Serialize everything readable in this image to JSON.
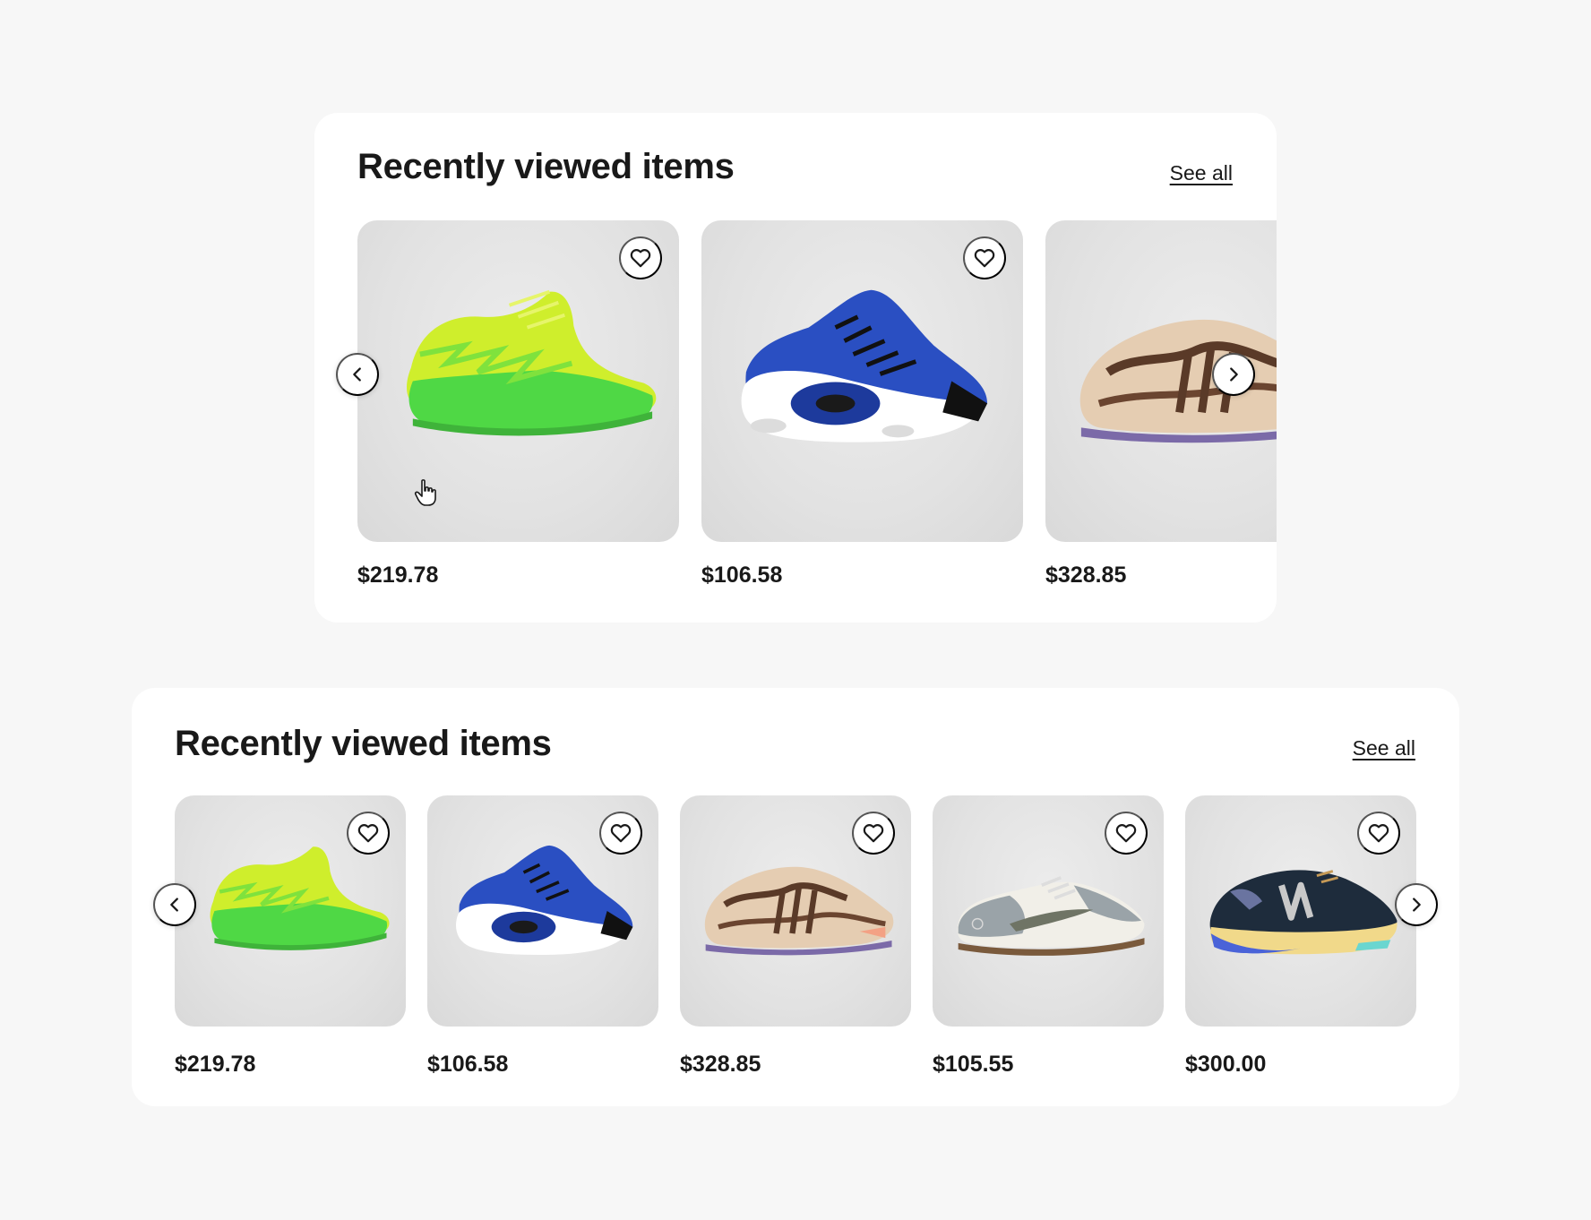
{
  "modules": [
    {
      "title": "Recently viewed items",
      "see_all": "See all",
      "items": [
        {
          "price": "$219.78",
          "shoe": "green-high-top",
          "colors": [
            "#d6f02a",
            "#4ad13f",
            "#56d844"
          ]
        },
        {
          "price": "$106.58",
          "shoe": "blue-white-mid",
          "colors": [
            "#2448b8",
            "#ffffff",
            "#1a1a1a"
          ]
        },
        {
          "price": "$328.85",
          "shoe": "tan-brown-runner",
          "colors": [
            "#e2c8ad",
            "#5a3a28",
            "#f3a184"
          ]
        }
      ],
      "prev_icon": "chevron-left-icon",
      "next_icon": "chevron-right-icon"
    },
    {
      "title": "Recently viewed items",
      "see_all": "See all",
      "items": [
        {
          "price": "$219.78",
          "shoe": "green-high-top",
          "colors": [
            "#d6f02a",
            "#4ad13f",
            "#56d844"
          ]
        },
        {
          "price": "$106.58",
          "shoe": "blue-white-mid",
          "colors": [
            "#2448b8",
            "#ffffff",
            "#1a1a1a"
          ]
        },
        {
          "price": "$328.85",
          "shoe": "tan-brown-runner",
          "colors": [
            "#e2c8ad",
            "#5a3a28",
            "#f3a184"
          ]
        },
        {
          "price": "$105.55",
          "shoe": "grey-white-low",
          "colors": [
            "#9aa3a8",
            "#f4f2ec",
            "#7c7560"
          ]
        },
        {
          "price": "$300.00",
          "shoe": "navy-yellow-runner",
          "colors": [
            "#1c2a3a",
            "#f1d98a",
            "#4a63d8"
          ]
        }
      ],
      "prev_icon": "chevron-left-icon",
      "next_icon": "chevron-right-icon"
    }
  ],
  "icons": {
    "favorite": "heart-icon",
    "cursor": "hand-pointer-icon"
  }
}
